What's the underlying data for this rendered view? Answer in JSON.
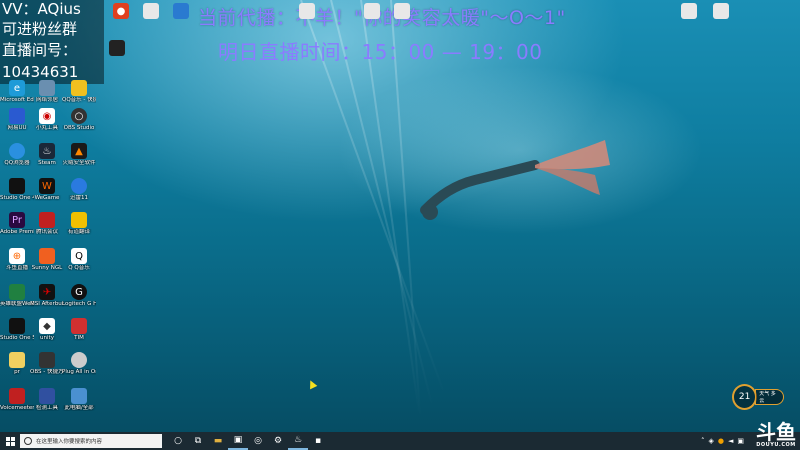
{
  "overlay": {
    "line1": "VV：AQius",
    "line2": "可进粉丝群",
    "line3": "直播间号：",
    "line4": "10434631"
  },
  "banner": {
    "line1": "当前代播：不羊！\"你的笑容太暖\"～O～1\"",
    "line2": "明日直播时间：15：00 — 19：00"
  },
  "desktop_icons": [
    {
      "label": "",
      "name": "icon-shortcut-1"
    },
    {
      "label": "Microsoft Edge",
      "name": "icon-edge"
    },
    {
      "label": "网络邻居",
      "name": "icon-network"
    },
    {
      "label": "QQ音乐 - 快捷方式",
      "name": "icon-qqmusic"
    },
    {
      "label": "网易UU",
      "name": "icon-uu"
    },
    {
      "label": "小丸工具",
      "name": "icon-tool"
    },
    {
      "label": "OBS Studio",
      "name": "icon-obs"
    },
    {
      "label": "QQ浏览器",
      "name": "icon-qqbrowser"
    },
    {
      "label": "Steam",
      "name": "icon-steam"
    },
    {
      "label": "火绒安全软件",
      "name": "icon-huorong"
    },
    {
      "label": "Studio One 4",
      "name": "icon-studioone"
    },
    {
      "label": "WeGame",
      "name": "icon-wegame"
    },
    {
      "label": "迅雷11",
      "name": "icon-xunlei"
    },
    {
      "label": "Adobe Premiere",
      "name": "icon-premiere"
    },
    {
      "label": "腾讯会议",
      "name": "icon-tencent-meeting"
    },
    {
      "label": "有道翻译",
      "name": "icon-youdao"
    },
    {
      "label": "斗鱼直播",
      "name": "icon-douyu"
    },
    {
      "label": "Sunny NGL",
      "name": "icon-sunny"
    },
    {
      "label": "Q Q音乐",
      "name": "icon-qq"
    },
    {
      "label": "英雄联盟WeGame版",
      "name": "icon-lol"
    },
    {
      "label": "MSI Afterburner",
      "name": "icon-msi"
    },
    {
      "label": "Logitech G HUB",
      "name": "icon-logitech"
    },
    {
      "label": "Studio One 5",
      "name": "icon-studioone5"
    },
    {
      "label": "unity",
      "name": "icon-unity"
    },
    {
      "label": "TIM",
      "name": "icon-tim"
    },
    {
      "label": "pr",
      "name": "icon-pr"
    },
    {
      "label": "OBS - 快捷方式",
      "name": "icon-obs-shortcut"
    },
    {
      "label": "Plug All in One",
      "name": "icon-plug"
    },
    {
      "label": "Voicemeeter Banana",
      "name": "icon-voicemeeter"
    },
    {
      "label": "检测工具",
      "name": "icon-check"
    },
    {
      "label": "此电脑/全部",
      "name": "icon-computer"
    }
  ],
  "top_icons": [
    {
      "label": "",
      "name": "top-icon-1"
    },
    {
      "label": "",
      "name": "top-icon-2"
    },
    {
      "label": "",
      "name": "top-icon-3"
    },
    {
      "label": "",
      "name": "top-icon-4"
    },
    {
      "label": "",
      "name": "top-icon-5"
    },
    {
      "label": "",
      "name": "top-icon-6"
    },
    {
      "label": "",
      "name": "top-icon-7"
    },
    {
      "label": "",
      "name": "top-icon-8"
    }
  ],
  "weather": {
    "temp": "21",
    "info": "天气 多云"
  },
  "taskbar": {
    "search_placeholder": "在这里输入你要搜索的内容"
  },
  "watermark": {
    "big": "斗鱼",
    "small": "DOUYU.COM"
  },
  "colors": {
    "banner": "#8a7cff",
    "taskbar": "#1b2a33",
    "water": "#0f7ea1"
  }
}
